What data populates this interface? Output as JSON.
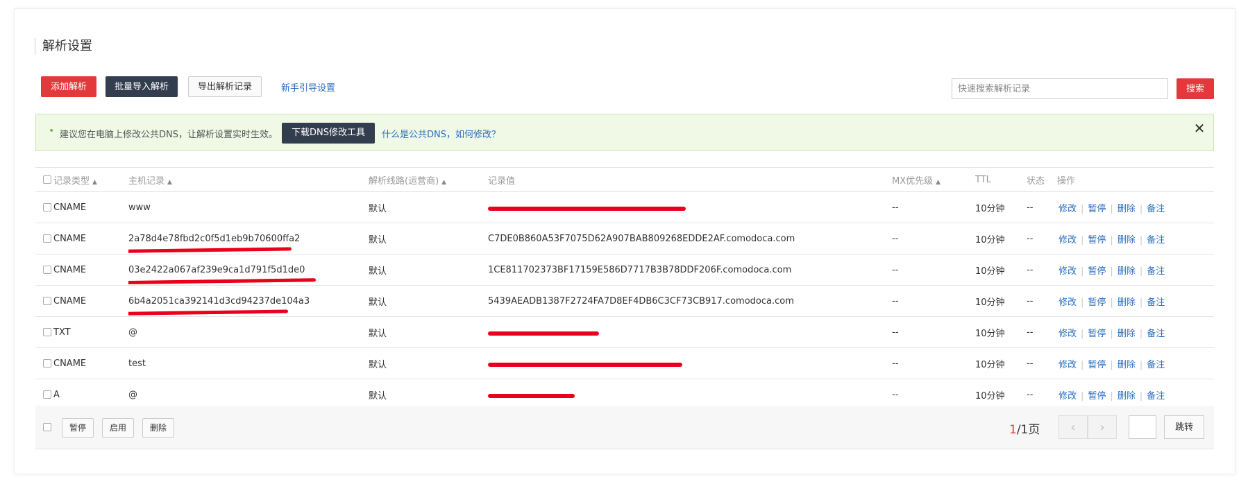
{
  "page_title": "解析设置",
  "toolbar": {
    "add_label": "添加解析",
    "batch_import_label": "批量导入解析",
    "export_label": "导出解析记录",
    "guide_link": "新手引导设置",
    "search_placeholder": "快速搜索解析记录",
    "search_label": "搜索"
  },
  "notice": {
    "bullet": "•",
    "message": "建议您在电脑上修改公共DNS，让解析设置实时生效。",
    "dns_tool_button": "下载DNS修改工具",
    "what_is_link": "什么是公共DNS，如何修改？",
    "close": "✕"
  },
  "table": {
    "headers": {
      "type": "记录类型",
      "host": "主机记录",
      "line": "解析线路(运营商)",
      "value": "记录值",
      "mx": "MX优先级",
      "ttl": "TTL",
      "status": "状态",
      "ops": "操作"
    },
    "sort_icon": "▲",
    "op_labels": {
      "edit": "修改",
      "pause": "暂停",
      "delete": "删除",
      "note": "备注",
      "sep": "|"
    },
    "rows": [
      {
        "type": "CNAME",
        "host": "www",
        "line": "默认",
        "value": "",
        "mx": "--",
        "ttl": "10分钟",
        "status": "--"
      },
      {
        "type": "CNAME",
        "host": "2a78d4e78fbd2c0f5d1eb9b70600ffa2",
        "line": "默认",
        "value": "C7DE0B860A53F7075D62A907BAB809268EDDE2AF.comodoca.com",
        "mx": "--",
        "ttl": "10分钟",
        "status": "--"
      },
      {
        "type": "CNAME",
        "host": "03e2422a067af239e9ca1d791f5d1de0",
        "line": "默认",
        "value": "1CE811702373BF17159E586D7717B3B78DDF206F.comodoca.com",
        "mx": "--",
        "ttl": "10分钟",
        "status": "--"
      },
      {
        "type": "CNAME",
        "host": "6b4a2051ca392141d3cd94237de104a3",
        "line": "默认",
        "value": "5439AEADB1387F2724FA7D8EF4DB6C3CF73CB917.comodoca.com",
        "mx": "--",
        "ttl": "10分钟",
        "status": "--"
      },
      {
        "type": "TXT",
        "host": "@",
        "line": "默认",
        "value": "",
        "mx": "--",
        "ttl": "10分钟",
        "status": "--"
      },
      {
        "type": "CNAME",
        "host": "test",
        "line": "默认",
        "value": "",
        "mx": "--",
        "ttl": "10分钟",
        "status": "--"
      },
      {
        "type": "A",
        "host": "@",
        "line": "默认",
        "value": "",
        "mx": "--",
        "ttl": "10分钟",
        "status": "--"
      }
    ]
  },
  "footer": {
    "pause_label": "暂停",
    "enable_label": "启用",
    "delete_label": "删除",
    "current_page": "1",
    "total_pages": "/1页",
    "prev_icon": "‹",
    "next_icon": "›",
    "jump_label": "跳转"
  },
  "colors": {
    "accent_red": "#e3393c",
    "dark_button": "#323d4e",
    "link_blue": "#2a6ebf",
    "redaction": "#e8001c"
  }
}
